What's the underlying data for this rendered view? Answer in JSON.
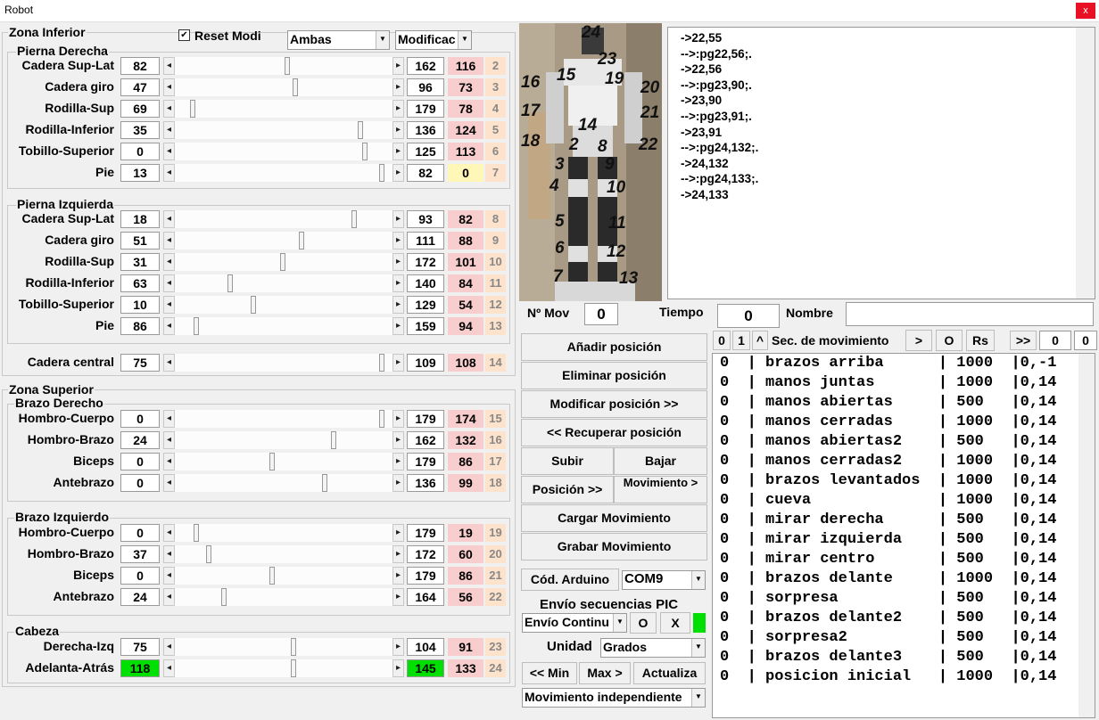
{
  "window": {
    "title": "Robot",
    "close": "x"
  },
  "lower": {
    "title": "Zona Inferior",
    "reset_label": "Reset Modi",
    "reset_checked": "✔",
    "mode_select": "Ambas",
    "mod_select": "Modificac",
    "right_leg": {
      "title": "Pierna Derecha",
      "joints": [
        {
          "label": "Cadera Sup-Lat",
          "value": "82",
          "pos": "162",
          "pink": "116",
          "idx": "2",
          "thumb": 0.52
        },
        {
          "label": "Cadera giro",
          "value": "47",
          "pos": "96",
          "pink": "73",
          "idx": "3",
          "thumb": 0.56
        },
        {
          "label": "Rodilla-Sup",
          "value": "69",
          "pos": "179",
          "pink": "78",
          "idx": "4",
          "thumb": 0.07
        },
        {
          "label": "Rodilla-Inferior",
          "value": "35",
          "pos": "136",
          "pink": "124",
          "idx": "5",
          "thumb": 0.87
        },
        {
          "label": "Tobillo-Superior",
          "value": "0",
          "pos": "125",
          "pink": "113",
          "idx": "6",
          "thumb": 0.89
        },
        {
          "label": "Pie",
          "value": "13",
          "pos": "82",
          "pink": "0",
          "idx": "7",
          "thumb": 0.97
        }
      ]
    },
    "left_leg": {
      "title": "Pierna Izquierda",
      "joints": [
        {
          "label": "Cadera Sup-Lat",
          "value": "18",
          "pos": "93",
          "pink": "82",
          "idx": "8",
          "thumb": 0.84
        },
        {
          "label": "Cadera giro",
          "value": "51",
          "pos": "111",
          "pink": "88",
          "idx": "9",
          "thumb": 0.59
        },
        {
          "label": "Rodilla-Sup",
          "value": "31",
          "pos": "172",
          "pink": "101",
          "idx": "10",
          "thumb": 0.5
        },
        {
          "label": "Rodilla-Inferior",
          "value": "63",
          "pos": "140",
          "pink": "84",
          "idx": "11",
          "thumb": 0.25
        },
        {
          "label": "Tobillo-Superior",
          "value": "10",
          "pos": "129",
          "pink": "54",
          "idx": "12",
          "thumb": 0.36
        },
        {
          "label": "Pie",
          "value": "86",
          "pos": "159",
          "pink": "94",
          "idx": "13",
          "thumb": 0.09
        }
      ]
    },
    "central": {
      "label": "Cadera central",
      "value": "75",
      "pos": "109",
      "pink": "108",
      "idx": "14",
      "thumb": 0.97
    }
  },
  "upper": {
    "title": "Zona Superior",
    "right_arm": {
      "title": "Brazo Derecho",
      "joints": [
        {
          "label": "Hombro-Cuerpo",
          "value": "0",
          "pos": "179",
          "pink": "174",
          "idx": "15",
          "thumb": 0.97
        },
        {
          "label": "Hombro-Brazo",
          "value": "24",
          "pos": "162",
          "pink": "132",
          "idx": "16",
          "thumb": 0.74
        },
        {
          "label": "Biceps",
          "value": "0",
          "pos": "179",
          "pink": "86",
          "idx": "17",
          "thumb": 0.45
        },
        {
          "label": "Antebrazo",
          "value": "0",
          "pos": "136",
          "pink": "99",
          "idx": "18",
          "thumb": 0.7
        }
      ]
    },
    "left_arm": {
      "title": "Brazo Izquierdo",
      "joints": [
        {
          "label": "Hombro-Cuerpo",
          "value": "0",
          "pos": "179",
          "pink": "19",
          "idx": "19",
          "thumb": 0.09
        },
        {
          "label": "Hombro-Brazo",
          "value": "37",
          "pos": "172",
          "pink": "60",
          "idx": "20",
          "thumb": 0.15
        },
        {
          "label": "Biceps",
          "value": "0",
          "pos": "179",
          "pink": "86",
          "idx": "21",
          "thumb": 0.45
        },
        {
          "label": "Antebrazo",
          "value": "24",
          "pos": "164",
          "pink": "56",
          "idx": "22",
          "thumb": 0.22
        }
      ]
    },
    "head": {
      "title": "Cabeza",
      "joints": [
        {
          "label": "Derecha-Izq",
          "value": "75",
          "pos": "104",
          "pink": "91",
          "idx": "23",
          "thumb": 0.55
        },
        {
          "label": "Adelanta-Atrás",
          "value": "118",
          "pos": "145",
          "pink": "133",
          "idx": "24",
          "thumb": 0.55,
          "green": true
        }
      ]
    }
  },
  "photo_numbers": [
    "24",
    "23",
    "15",
    "19",
    "16",
    "20",
    "17",
    "21",
    "14",
    "18",
    "22",
    "2",
    "8",
    "3",
    "9",
    "4",
    "10",
    "5",
    "11",
    "6",
    "12",
    "7",
    "13"
  ],
  "log": [
    "->22,55",
    "-->:pg22,56;.",
    "->22,56",
    "-->:pg23,90;.",
    "->23,90",
    "-->:pg23,91;.",
    "->23,91",
    "-->:pg24,132;.",
    "->24,132",
    "-->:pg24,133;.",
    "->24,133"
  ],
  "controls": {
    "nmov_label": "Nº Mov",
    "nmov_value": "0",
    "tiempo_label": "Tiempo (ms)",
    "tiempo_value": "0",
    "nombre_label": "Nombre",
    "nombre_value": "",
    "add": "Añadir posición",
    "delete": "Eliminar posición",
    "modify": "Modificar posición >>",
    "recover": "<< Recuperar posición",
    "up": "Subir",
    "down": "Bajar",
    "position": "Posición >>",
    "movement": "Movimiento >",
    "load": "Cargar Movimiento",
    "save": "Grabar Movimiento",
    "arduino_label": "Cód. Arduino",
    "com": "COM9",
    "pic_label": "Envío secuencias PIC",
    "envio": "Envío Continu",
    "o": "O",
    "x": "X",
    "unit_label": "Unidad",
    "unit": "Grados",
    "min": "<< Min",
    "max": "Max >",
    "update": "Actualiza",
    "mode": "Movimiento independiente"
  },
  "sequence_bar": {
    "b0": "0",
    "b1": "1",
    "caret": "^",
    "title": "Sec. de movimiento",
    "gt": ">",
    "o": "O",
    "rs": "Rs",
    "ff": ">>",
    "v1": "0",
    "v2": "0"
  },
  "sequence": [
    "0  | brazos arriba      | 1000  |0,-1",
    "0  | manos juntas       | 1000  |0,14",
    "0  | manos abiertas     | 500   |0,14",
    "0  | manos cerradas     | 1000  |0,14",
    "0  | manos abiertas2    | 500   |0,14",
    "0  | manos cerradas2    | 1000  |0,14",
    "0  | brazos levantados  | 1000  |0,14",
    "0  | cueva              | 1000  |0,14",
    "0  | mirar derecha      | 500   |0,14",
    "0  | mirar izquierda    | 500   |0,14",
    "0  | mirar centro       | 500   |0,14",
    "0  | brazos delante     | 1000  |0,14",
    "0  | sorpresa           | 500   |0,14",
    "0  | brazos delante2    | 500   |0,14",
    "0  | sorpresa2          | 500   |0,14",
    "0  | brazos delante3    | 500   |0,14",
    "0  | posicion inicial   | 1000  |0,14"
  ]
}
